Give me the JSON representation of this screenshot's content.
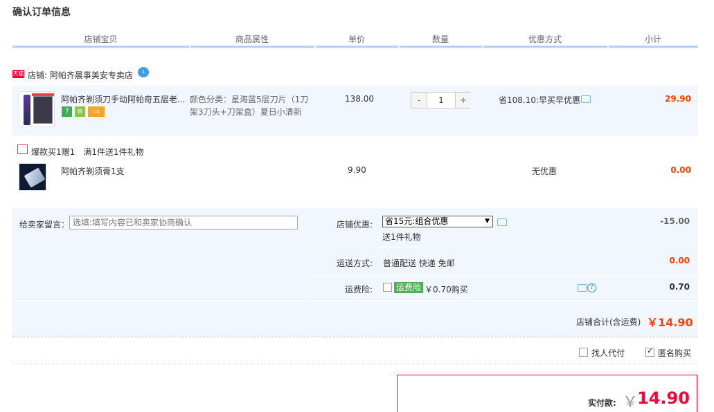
{
  "title": "确认订单信息",
  "headers": [
    "店铺宝贝",
    "商品属性",
    "单价",
    "数量",
    "优惠方式",
    "小计"
  ],
  "shop": {
    "tag": "天猫",
    "name": "店铺: 阿帕齐晨事美安专卖店"
  },
  "item": {
    "name": "阿帕齐剃须刀手动阿帕奇五层老...",
    "attr": "颜色分类：星海蓝5层刀片（1刀架3刀头+刀架盒）夏日小清新",
    "price": "138.00",
    "qty_minus": "-",
    "qty": "1",
    "qty_plus": "+",
    "promo": "省108.10:早买早优惠",
    "subtotal": "29.90",
    "badge7": "7"
  },
  "gift": {
    "header": "爆款买1赠1　满1件送1件礼物",
    "name": "阿帕齐剃须膏1支",
    "price": "9.90",
    "promo": "无优惠",
    "subtotal": "0.00"
  },
  "order": {
    "message_label": "给卖家留言：",
    "message_placeholder": "选填:填写内容已和卖家协商确认",
    "shop_discount_label": "店铺优惠:",
    "shop_discount_selected": "省15元:组合优惠",
    "shop_discount_note": "送1件礼物",
    "shop_discount_amount": "-15.00",
    "shipping_label": "运送方式:",
    "shipping_value": "普通配送 快递 免邮",
    "shipping_amount": "0.00",
    "insurance_label": "运费险:",
    "insurance_tag": "运费险",
    "insurance_value": "￥0.70购买",
    "insurance_amount": "0.70",
    "total_label": "店铺合计(含运费)",
    "total_amount": "￥14.90"
  },
  "options": {
    "proxy_pay": "找人代付",
    "anonymous": "匿名购买"
  },
  "payment": {
    "label": "实付款:",
    "yen": "￥",
    "amount": "14.90"
  }
}
